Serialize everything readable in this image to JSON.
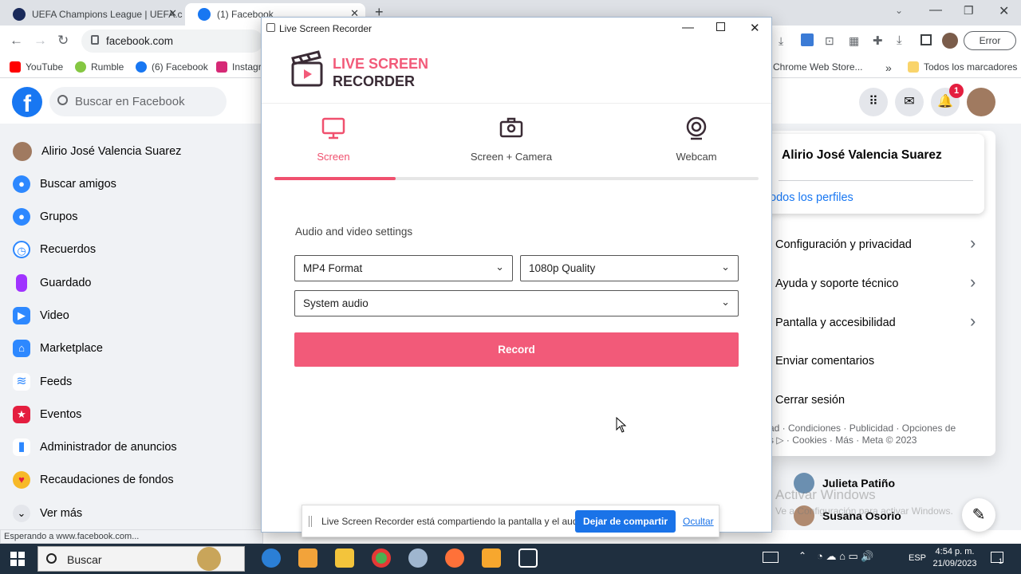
{
  "browser": {
    "tabs": [
      {
        "title": "UEFA Champions League | UEFA.c"
      },
      {
        "title": "(1) Facebook"
      }
    ],
    "new_tab": "+",
    "url": "facebook.com",
    "error_label": "Error",
    "bookmarks": [
      "YouTube",
      "Rumble",
      "(6) Facebook",
      "Instagr",
      "Chrome Web Store...",
      "Todos los marcadores"
    ],
    "status": "Esperando a www.facebook.com..."
  },
  "facebook": {
    "logo": "f",
    "search_placeholder": "Buscar en Facebook",
    "notification_count": "1",
    "sidebar": [
      {
        "label": "Alirio José Valencia Suarez",
        "icon": "avatar"
      },
      {
        "label": "Buscar amigos",
        "icon": "friends-icon"
      },
      {
        "label": "Grupos",
        "icon": "groups-icon"
      },
      {
        "label": "Recuerdos",
        "icon": "memories-icon"
      },
      {
        "label": "Guardado",
        "icon": "saved-icon"
      },
      {
        "label": "Video",
        "icon": "video-icon"
      },
      {
        "label": "Marketplace",
        "icon": "marketplace-icon"
      },
      {
        "label": "Feeds",
        "icon": "feeds-icon"
      },
      {
        "label": "Eventos",
        "icon": "events-icon"
      },
      {
        "label": "Administrador de anuncios",
        "icon": "ads-icon"
      },
      {
        "label": "Recaudaciones de fondos",
        "icon": "fundraiser-icon"
      },
      {
        "label": "Ver más",
        "icon": "chevron-down-icon"
      }
    ],
    "account": {
      "name": "Alirio José Valencia Suarez",
      "all_profiles": "odos los perfiles",
      "menu": [
        "Configuración y privacidad",
        "Ayuda y soporte técnico",
        "Pantalla y accesibilidad",
        "Enviar comentarios",
        "Cerrar sesión"
      ],
      "footer_line1": "ad · Condiciones · Publicidad · Opciones de",
      "footer_line2": "s ▷ · Cookies · Más · Meta © 2023"
    },
    "contacts": [
      "Julieta Patiño",
      "Susana Osorio"
    ],
    "watermark_title": "Activar Windows",
    "watermark_sub": "Ve a Configuración para activar Windows."
  },
  "recorder": {
    "window_title": "Live Screen Recorder",
    "logo_line1": "LIVE SCREEN",
    "logo_line2": "RECORDER",
    "modes": [
      "Screen",
      "Screen + Camera",
      "Webcam"
    ],
    "active_mode": 0,
    "settings_title": "Audio and video settings",
    "format": "MP4 Format",
    "quality": "1080p Quality",
    "audio": "System audio",
    "record_label": "Record",
    "accent": "#f25a79"
  },
  "sharing_bar": {
    "message": "Live Screen Recorder está compartiendo la pantalla y el audio.",
    "stop_label": "Dejar de compartir",
    "hide_label": "Ocultar"
  },
  "taskbar": {
    "search": "Buscar",
    "lang": "ESP",
    "time": "4:54 p. m.",
    "date": "21/09/2023",
    "notif_count": "1"
  }
}
